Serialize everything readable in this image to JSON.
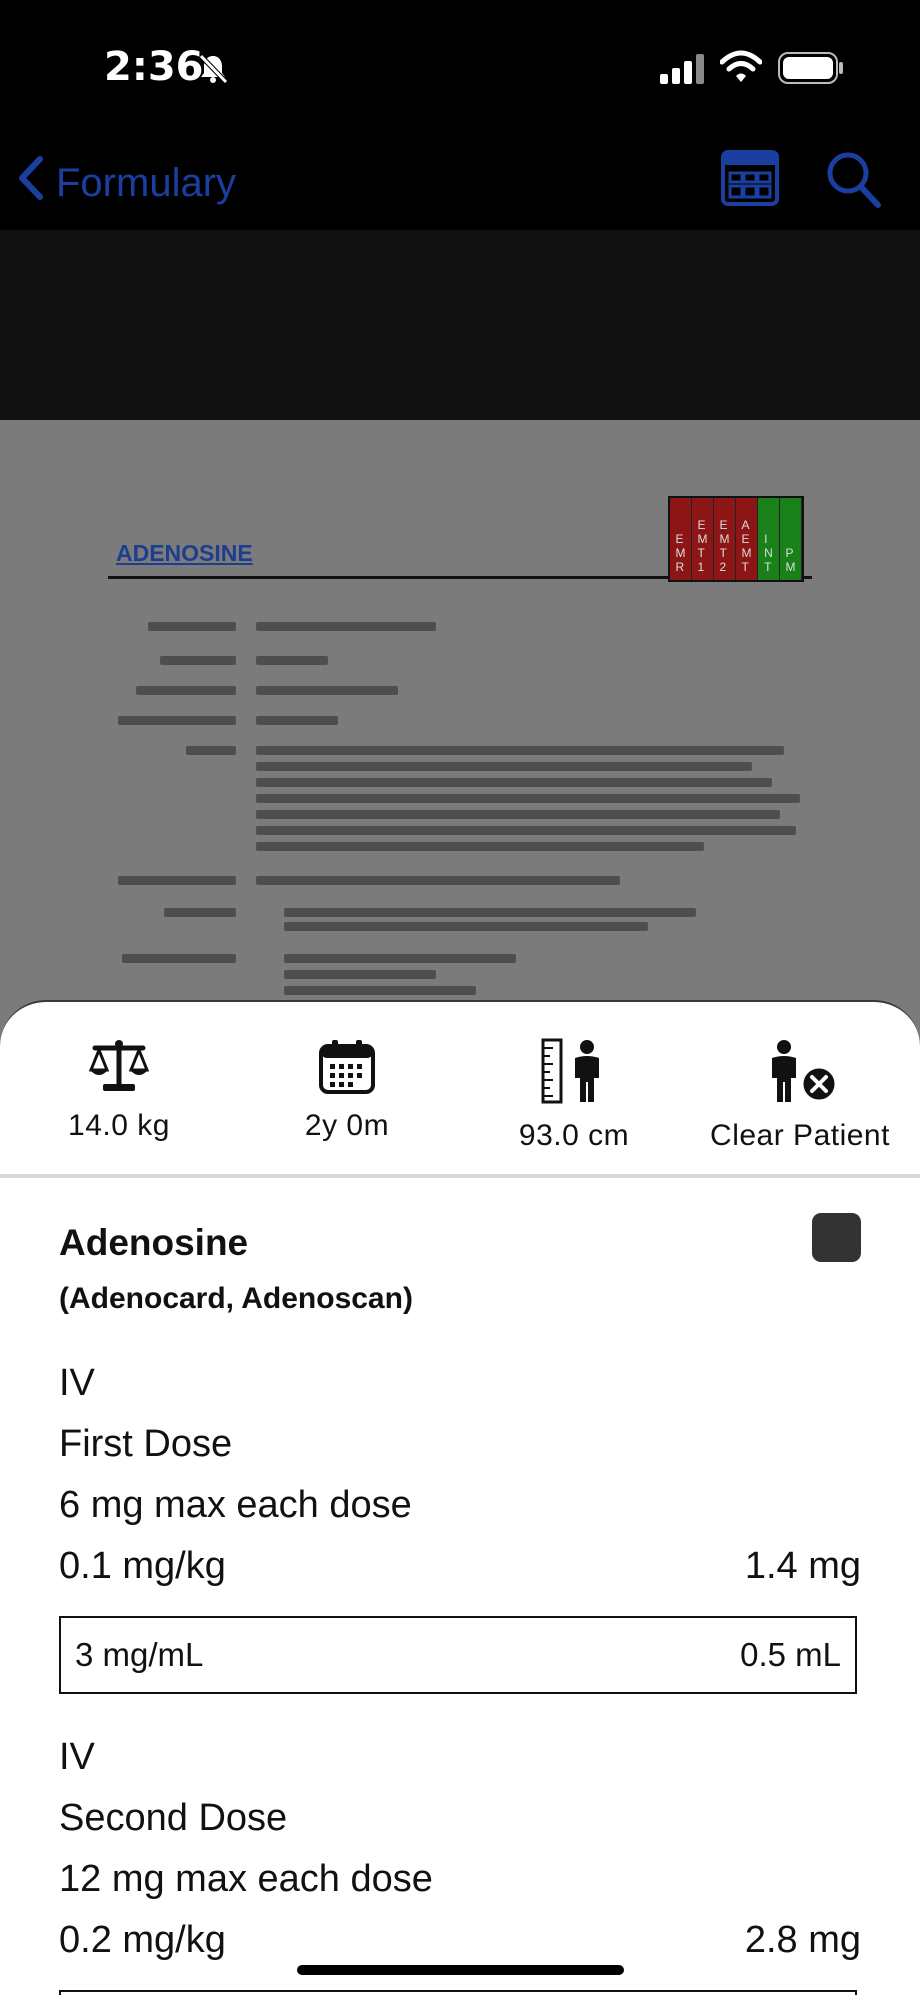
{
  "status_bar": {
    "time": "2:36"
  },
  "nav": {
    "back_label": "Formulary"
  },
  "document": {
    "title": "ADENOSINE",
    "levels": [
      {
        "text": "EMR",
        "color": "#8c1515"
      },
      {
        "text": "EMT1",
        "color": "#8c1515"
      },
      {
        "text": "EMT2",
        "color": "#8c1515"
      },
      {
        "text": "AEMT",
        "color": "#8c1515"
      },
      {
        "text": "INT",
        "color": "#1a801a"
      },
      {
        "text": "PM",
        "color": "#1a801a"
      }
    ]
  },
  "patient": {
    "weight": "14.0 kg",
    "age": "2y 0m",
    "height": "93.0 cm",
    "clear_label": "Clear Patient"
  },
  "drug": {
    "name": "Adenosine",
    "brands": "(Adenocard, Adenoscan)",
    "doses": [
      {
        "route": "IV",
        "label": "First Dose",
        "max": "6 mg max each dose",
        "rate": "0.1 mg/kg",
        "amount": "1.4 mg",
        "concentration": "3 mg/mL",
        "volume": "0.5 mL"
      },
      {
        "route": "IV",
        "label": "Second Dose",
        "max": "12 mg max each dose",
        "rate": "0.2 mg/kg",
        "amount": "2.8 mg"
      }
    ]
  }
}
